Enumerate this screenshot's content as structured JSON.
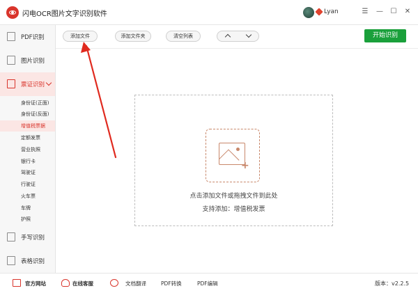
{
  "window": {
    "title": "闪电OCR图片文字识别软件",
    "user": "Lyan",
    "controls": {
      "menu": "☰",
      "minimize": "—",
      "maximize": "☐",
      "close": "✕"
    }
  },
  "sidebar": {
    "items": [
      {
        "label": "PDF识别"
      },
      {
        "label": "图片识别"
      },
      {
        "label": "票证识别"
      },
      {
        "label": "手写识别"
      },
      {
        "label": "表格识别"
      }
    ],
    "sub_items": [
      {
        "label": "身份证(正面)"
      },
      {
        "label": "身份证(反面)"
      },
      {
        "label": "增值税票据"
      },
      {
        "label": "定额发票"
      },
      {
        "label": "营业执照"
      },
      {
        "label": "银行卡"
      },
      {
        "label": "驾驶证"
      },
      {
        "label": "行驶证"
      },
      {
        "label": "火车票"
      },
      {
        "label": "车牌"
      },
      {
        "label": "护照"
      }
    ],
    "active_item": "票证识别",
    "active_sub_item": "增值税票据"
  },
  "toolbar": {
    "add_file": "添加文件",
    "add_folder": "添加文件夹",
    "clear_list": "清空列表",
    "start": "开始识别"
  },
  "dropzone": {
    "hint": "点击添加文件或拖拽文件到此处",
    "support": "支持添加：增值税发票"
  },
  "footer": {
    "website": "官方网站",
    "support": "在线客服",
    "translate": "文档翻译",
    "pdf_convert": "PDF转换",
    "pdf_edit": "PDF编辑",
    "version": "版本：v2.2.5"
  },
  "colors": {
    "accent": "#d9342b",
    "start_button": "#1aa03b",
    "upload_icon": "#c8876a"
  }
}
